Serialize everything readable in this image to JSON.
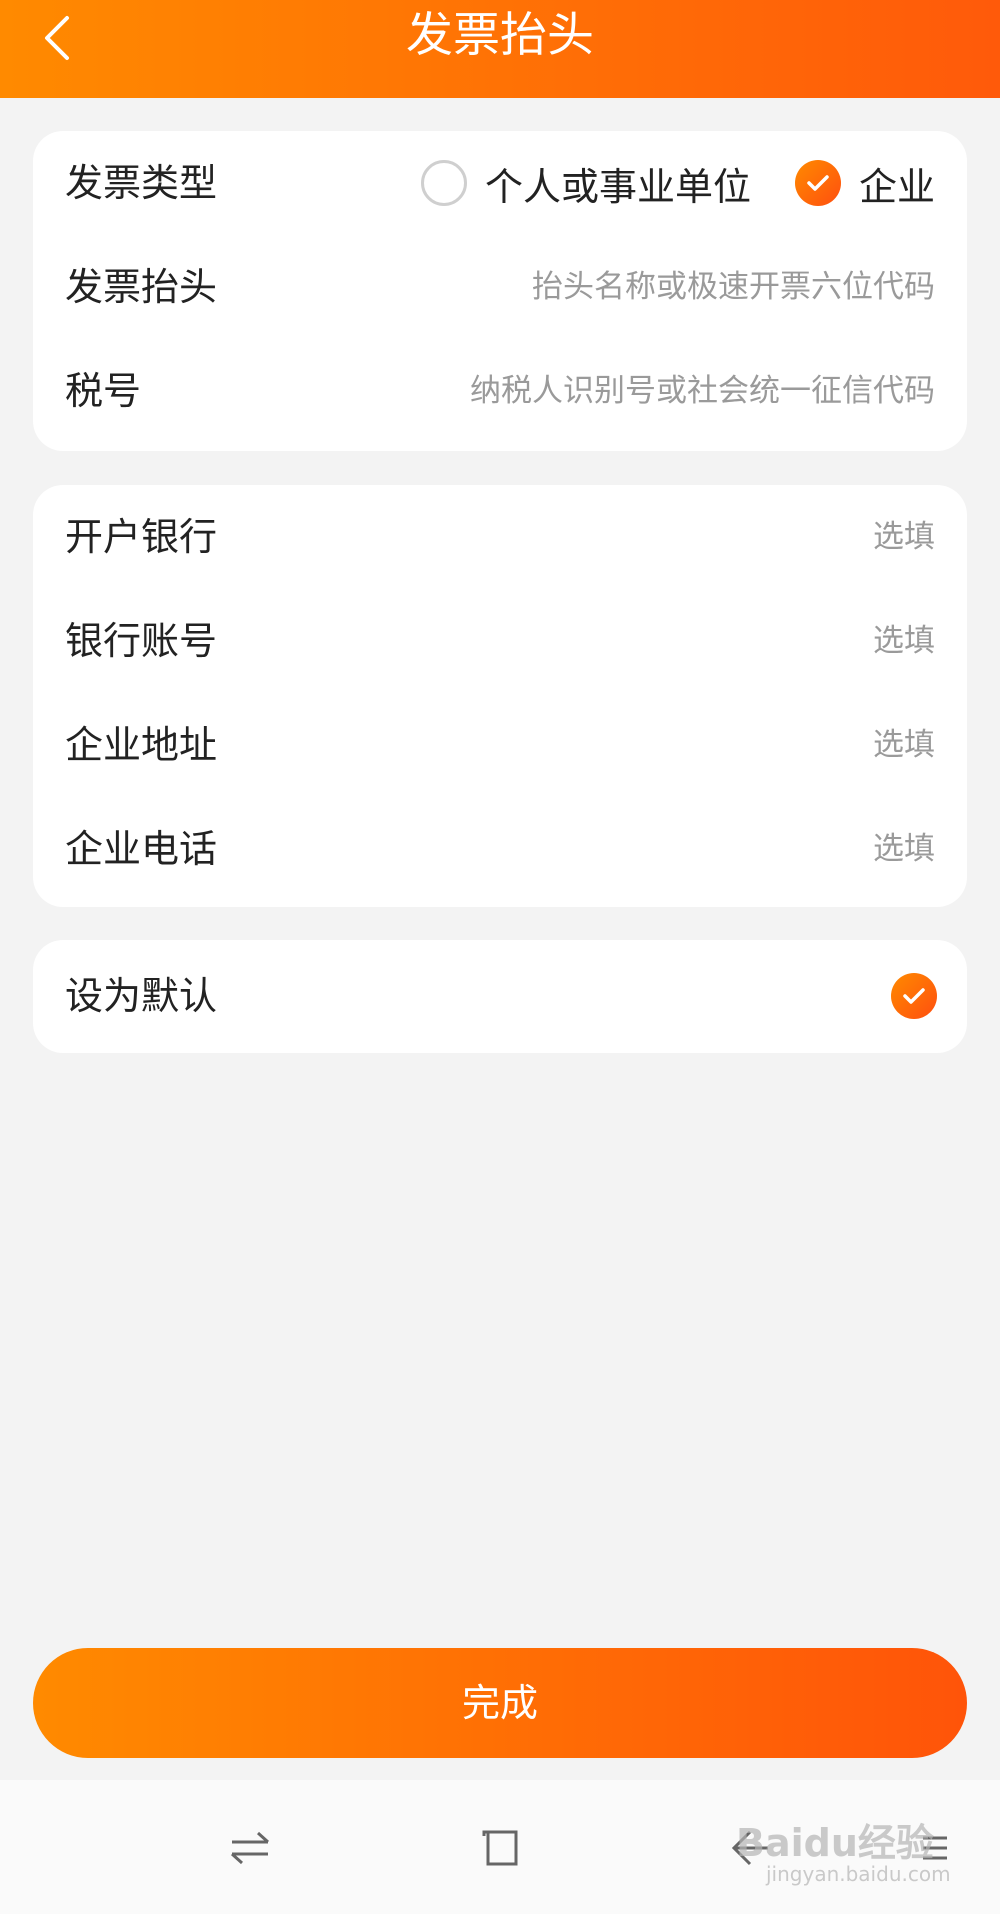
{
  "header": {
    "title": "发票抬头"
  },
  "invoice_card": {
    "type_label": "发票类型",
    "type_options": [
      {
        "label": "个人或事业单位",
        "selected": false
      },
      {
        "label": "企业",
        "selected": true
      }
    ],
    "title_label": "发票抬头",
    "title_placeholder": "抬头名称或极速开票六位代码",
    "tax_label": "税号",
    "tax_placeholder": "纳税人识别号或社会统一征信代码"
  },
  "bank_card": {
    "rows": [
      {
        "label": "开户银行",
        "placeholder": "选填"
      },
      {
        "label": "银行账号",
        "placeholder": "选填"
      },
      {
        "label": "企业地址",
        "placeholder": "选填"
      },
      {
        "label": "企业电话",
        "placeholder": "选填"
      }
    ]
  },
  "default_card": {
    "label": "设为默认",
    "checked": true
  },
  "submit": {
    "label": "完成"
  },
  "watermark": {
    "brand": "Baidu经验",
    "url": "jingyan.baidu.com"
  },
  "colors": {
    "accent_start": "#ff8a00",
    "accent_end": "#ff5409",
    "background": "#f3f3f3"
  }
}
